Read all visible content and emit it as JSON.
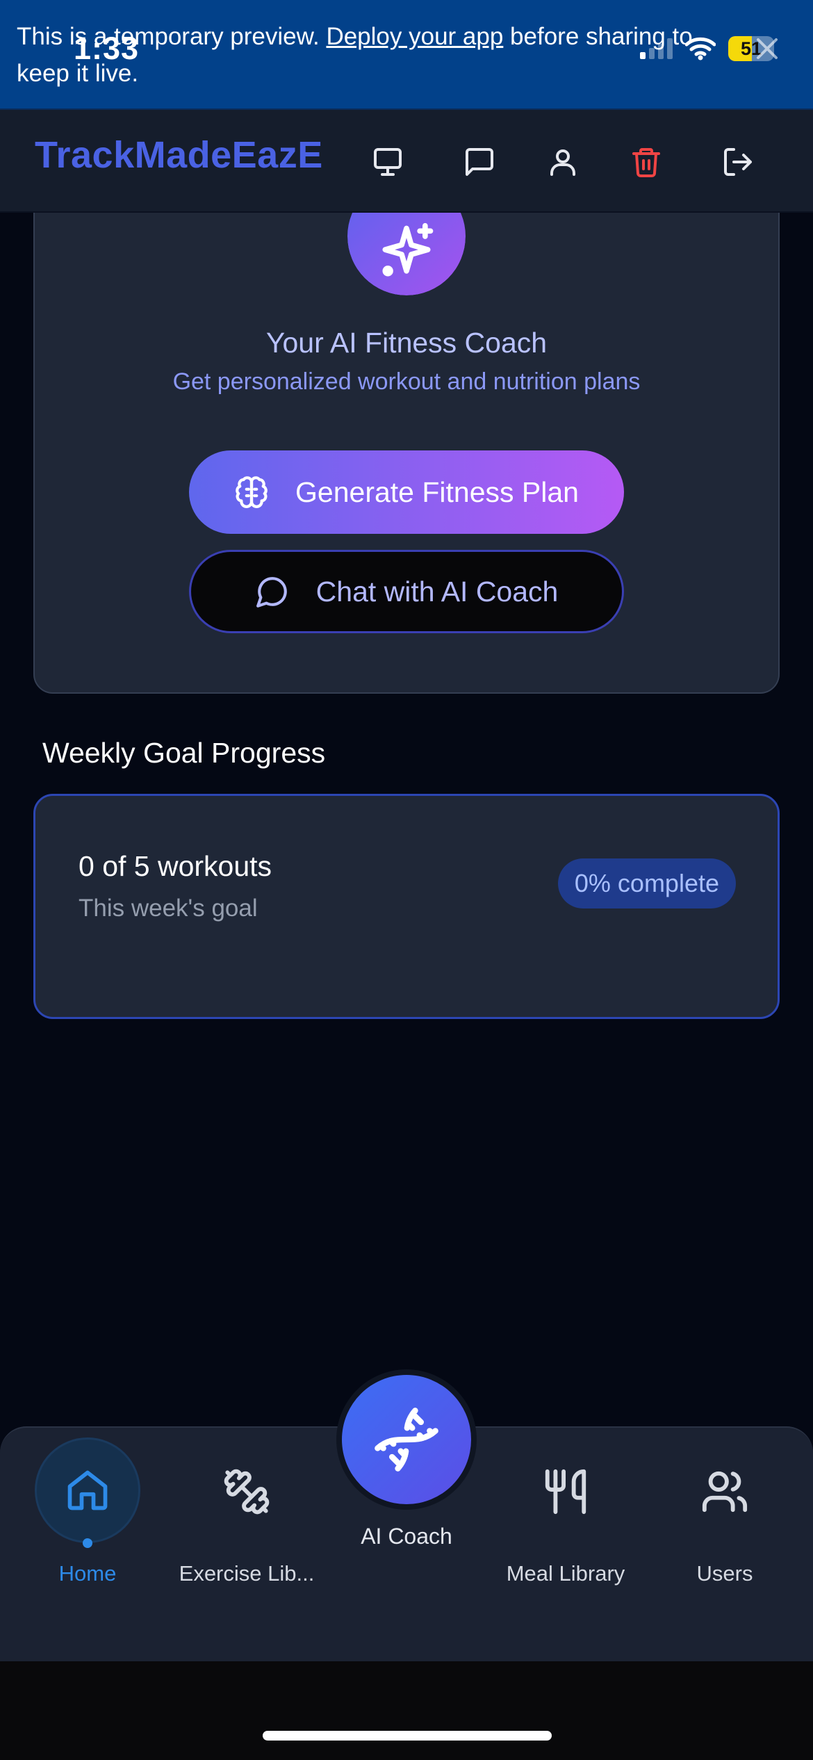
{
  "banner": {
    "text_before": "This is a temporary preview. ",
    "link": "Deploy your app",
    "text_after": " before sharing to keep it live."
  },
  "status_bar": {
    "time": "1:33",
    "battery": "51",
    "battery_level": 0.51,
    "icons": [
      "signal-icon",
      "wifi-icon",
      "battery-icon",
      "close-icon"
    ]
  },
  "header": {
    "logo": "TrackMadeEazE",
    "icons": [
      "monitor-icon",
      "message-icon",
      "user-icon",
      "trash-icon",
      "logout-icon"
    ],
    "colors": {
      "logo": "#4a62e4",
      "danger": "#ef4444"
    }
  },
  "coach": {
    "title": "Your AI Fitness Coach",
    "subtitle": "Get personalized workout and nutrition plans",
    "generate_label": "Generate Fitness Plan",
    "chat_label": "Chat with AI Coach",
    "icons": [
      "sparkles-icon",
      "brain-icon",
      "chat-bubble-icon"
    ]
  },
  "weekly_goal": {
    "section_title": "Weekly Goal Progress",
    "count": "0 of 5 workouts",
    "label": "This week's goal",
    "badge": "0% complete",
    "completed": 0,
    "target": 5
  },
  "nav": {
    "home": "Home",
    "exercise": "Exercise Lib...",
    "ai_coach": "AI Coach",
    "meals": "Meal Library",
    "users": "Users",
    "active": "Home",
    "colors": {
      "active": "#2d8ae8"
    },
    "icons": [
      "home-icon",
      "dumbbell-icon",
      "dna-icon",
      "utensils-icon",
      "users-icon"
    ]
  }
}
